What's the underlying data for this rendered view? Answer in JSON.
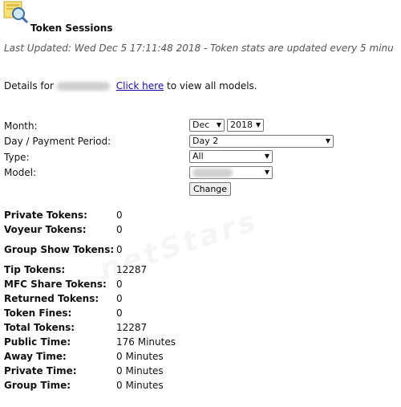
{
  "header": {
    "title": "Token Sessions",
    "last_updated": "Last Updated: Wed Dec 5 17:11:48 2018 - Token stats are updated every 5 minu"
  },
  "details": {
    "prefix": "Details for",
    "link_text": "Click here",
    "suffix": "to view all models."
  },
  "form": {
    "month_label": "Month:",
    "period_label": "Day / Payment Period:",
    "type_label": "Type:",
    "model_label": "Model:",
    "month_value": "Dec",
    "year_value": "2018",
    "period_value": "Day 2",
    "type_value": "All",
    "change_button": "Change"
  },
  "watermark": "netStars",
  "stats": [
    {
      "label": "Private Tokens:",
      "value": "0"
    },
    {
      "label": "Voyeur Tokens:",
      "value": "0"
    },
    {
      "label": "Group Show Tokens:",
      "value": "0"
    },
    {
      "label": "Tip Tokens:",
      "value": "12287"
    },
    {
      "label": "MFC Share Tokens:",
      "value": "0"
    },
    {
      "label": "Returned Tokens:",
      "value": "0"
    },
    {
      "label": "Token Fines:",
      "value": "0"
    },
    {
      "label": "Total Tokens:",
      "value": "12287"
    },
    {
      "label": "Public Time:",
      "value": "176 Minutes"
    },
    {
      "label": "Away Time:",
      "value": "0 Minutes"
    },
    {
      "label": "Private Time:",
      "value": "0 Minutes"
    },
    {
      "label": "Group Time:",
      "value": "0 Minutes"
    }
  ]
}
